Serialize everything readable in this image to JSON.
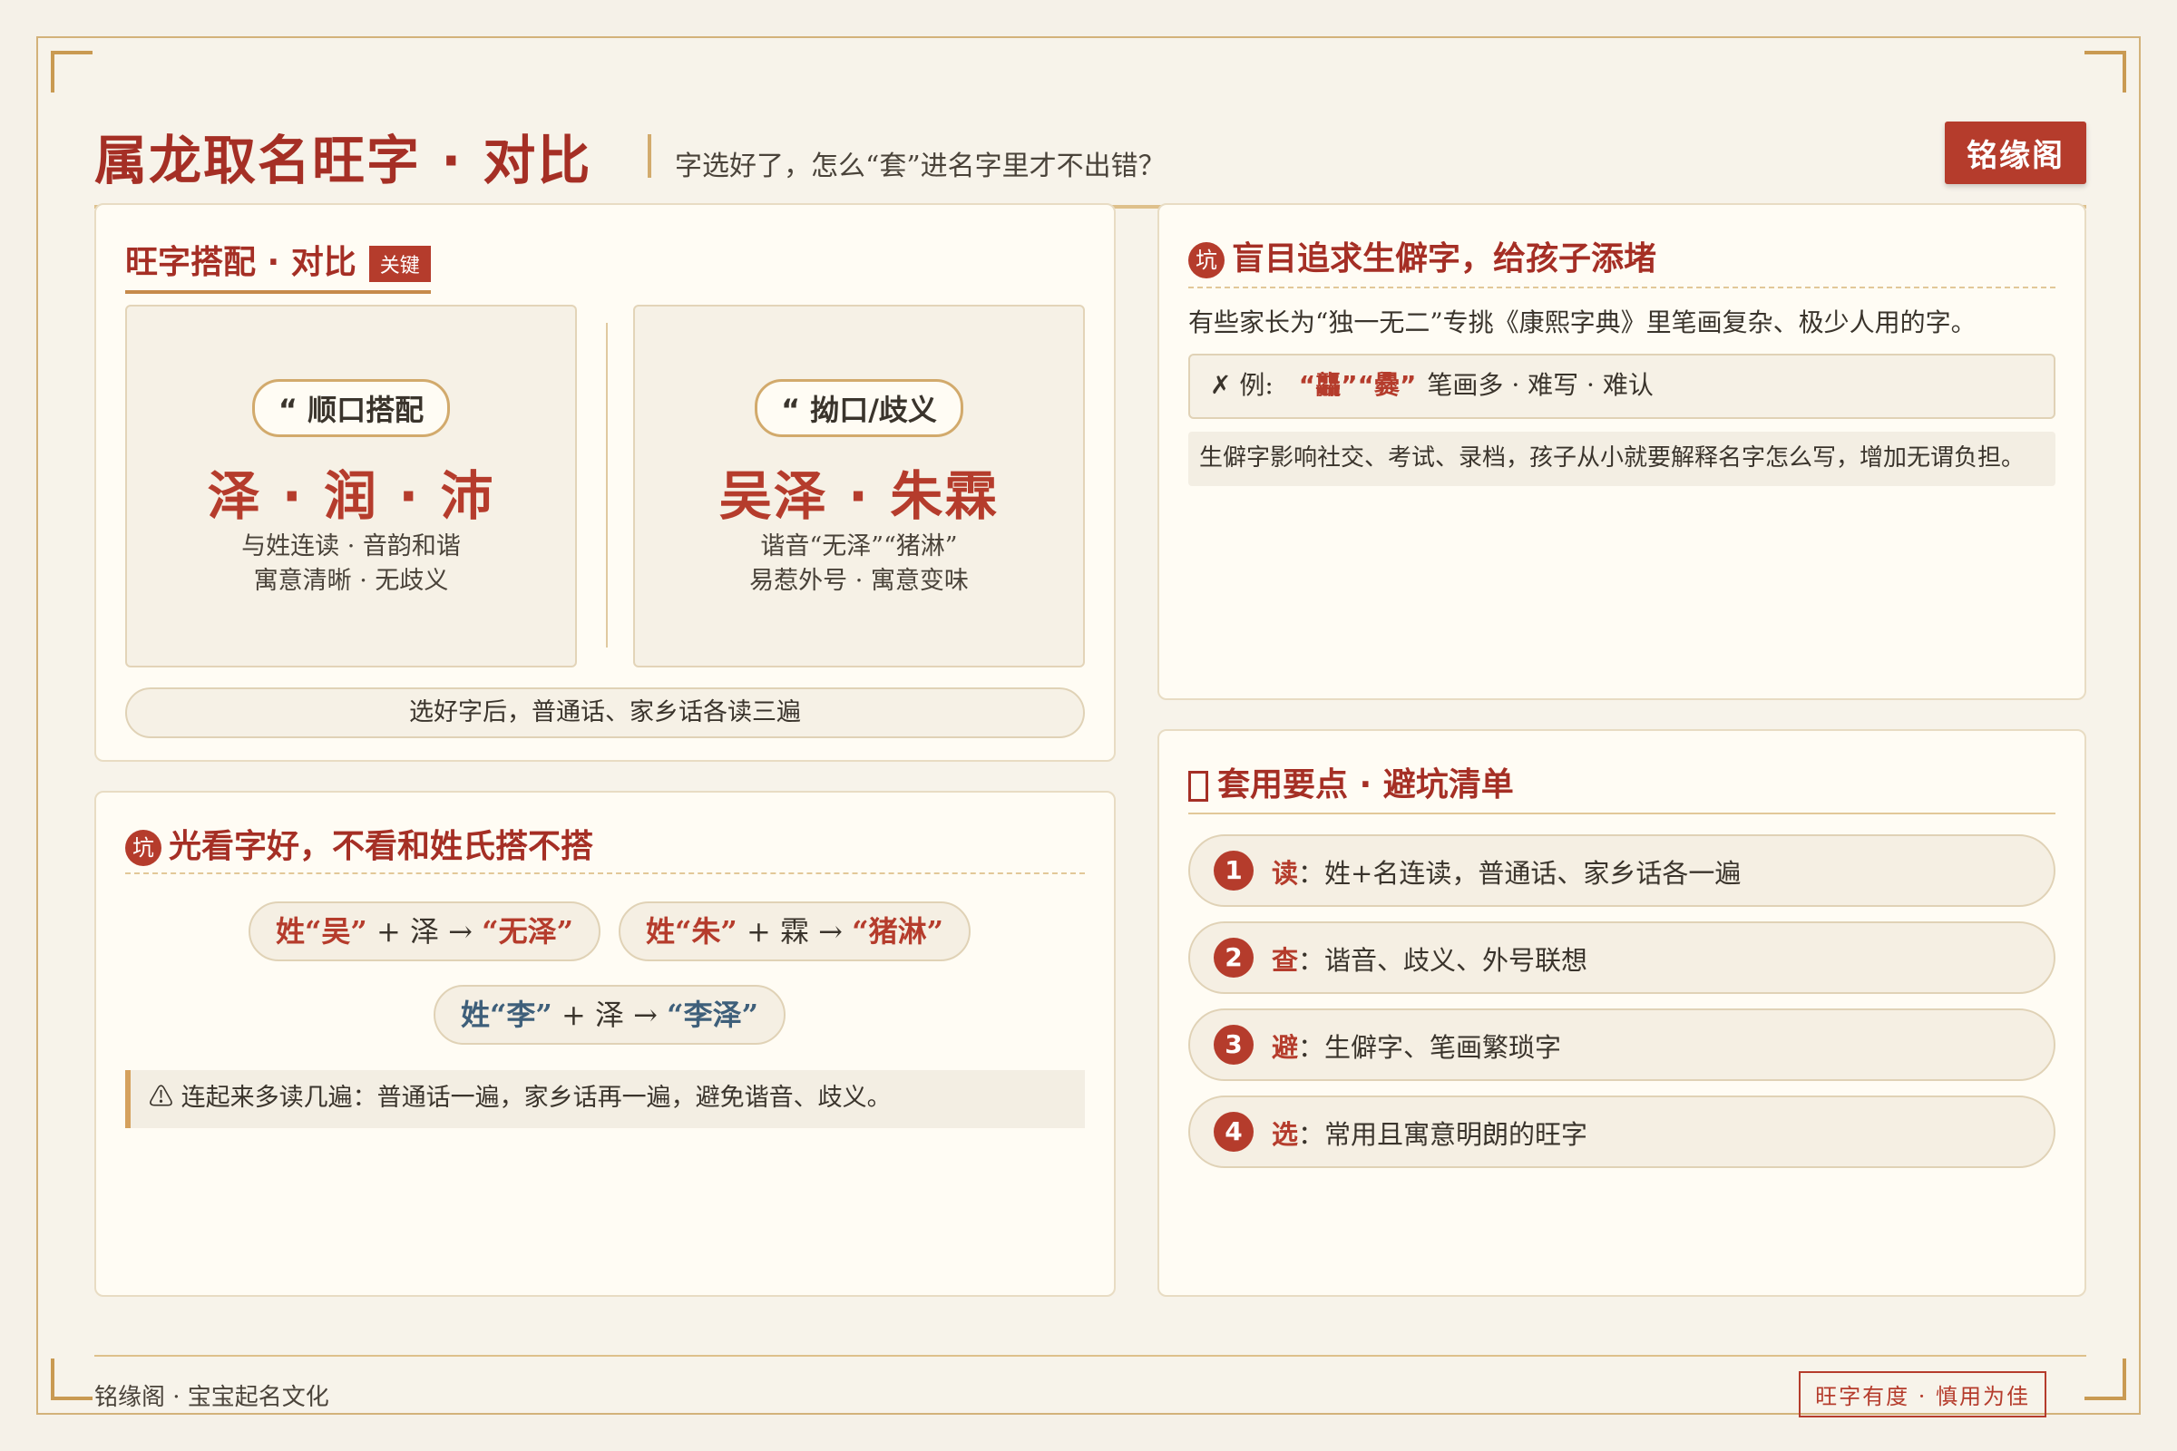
{
  "header": {
    "title": "属龙取名旺字 · 对比",
    "subtitle": "字选好了，怎么“套”进名字里才不出错？",
    "brand": "铭缘阁"
  },
  "compare": {
    "title": "旺字搭配 · 对比",
    "badge": "关键",
    "good": {
      "label": "“ 顺口搭配",
      "chars": "泽 · 润 · 沛",
      "line1": "与姓连读 · 音韵和谐",
      "line2": "寓意清晰 · 无歧义"
    },
    "bad": {
      "label": "“ 拗口/歧义",
      "chars": "吴泽 · 朱霖",
      "line1": "谐音“无泽”“猪淋”",
      "line2": "易惹外号 · 寓意变味"
    },
    "tip": "选好字后，普通话、家乡话各读三遍"
  },
  "surname": {
    "icon": "坑",
    "title": "光看字好，不看和姓氏搭不搭",
    "examples": [
      {
        "surname": "姓“吴”",
        "plus": " + 泽 → ",
        "result": "“无泽”"
      },
      {
        "surname": "姓“朱”",
        "plus": " + 霖 → ",
        "result": "“猪淋”"
      },
      {
        "surname": "姓“李”",
        "plus": " + 泽 → ",
        "result": "“李泽”"
      }
    ],
    "warning": "⚠ 连起来多读几遍：普通话一遍，家乡话再一遍，避免谐音、歧义。"
  },
  "rare": {
    "icon": "坑",
    "title": "盲目追求生僻字，给孩子添堵",
    "desc": "有些家长为“独一无二”专挑《康熙字典》里笔画复杂、极少人用的字。",
    "example_prefix": "✗ 例:",
    "example_chars": "“龘”“爨”",
    "example_note": "笔画多 · 难写 · 难认",
    "note": "生僻字影响社交、考试、录档，孩子从小就要解释名字怎么写，增加无谓负担。"
  },
  "checklist": {
    "icon": "check-icon",
    "title": "套用要点 · 避坑清单",
    "items": [
      {
        "num": "1",
        "key": "读",
        "text": "：姓+名连读，普通话、家乡话各一遍"
      },
      {
        "num": "2",
        "key": "查",
        "text": "：谐音、歧义、外号联想"
      },
      {
        "num": "3",
        "key": "避",
        "text": "：生僻字、笔画繁琐字"
      },
      {
        "num": "4",
        "key": "选",
        "text": "：常用且寓意明朗的旺字"
      }
    ]
  },
  "footer": {
    "left": "铭缘阁 · 宝宝起名文化",
    "stamp": "旺字有度 · 慎用为佳"
  },
  "colors": {
    "accent": "#b53c2c",
    "gold": "#d3b27a",
    "background": "#f5f1e8",
    "blue": "#3e5f7a"
  }
}
